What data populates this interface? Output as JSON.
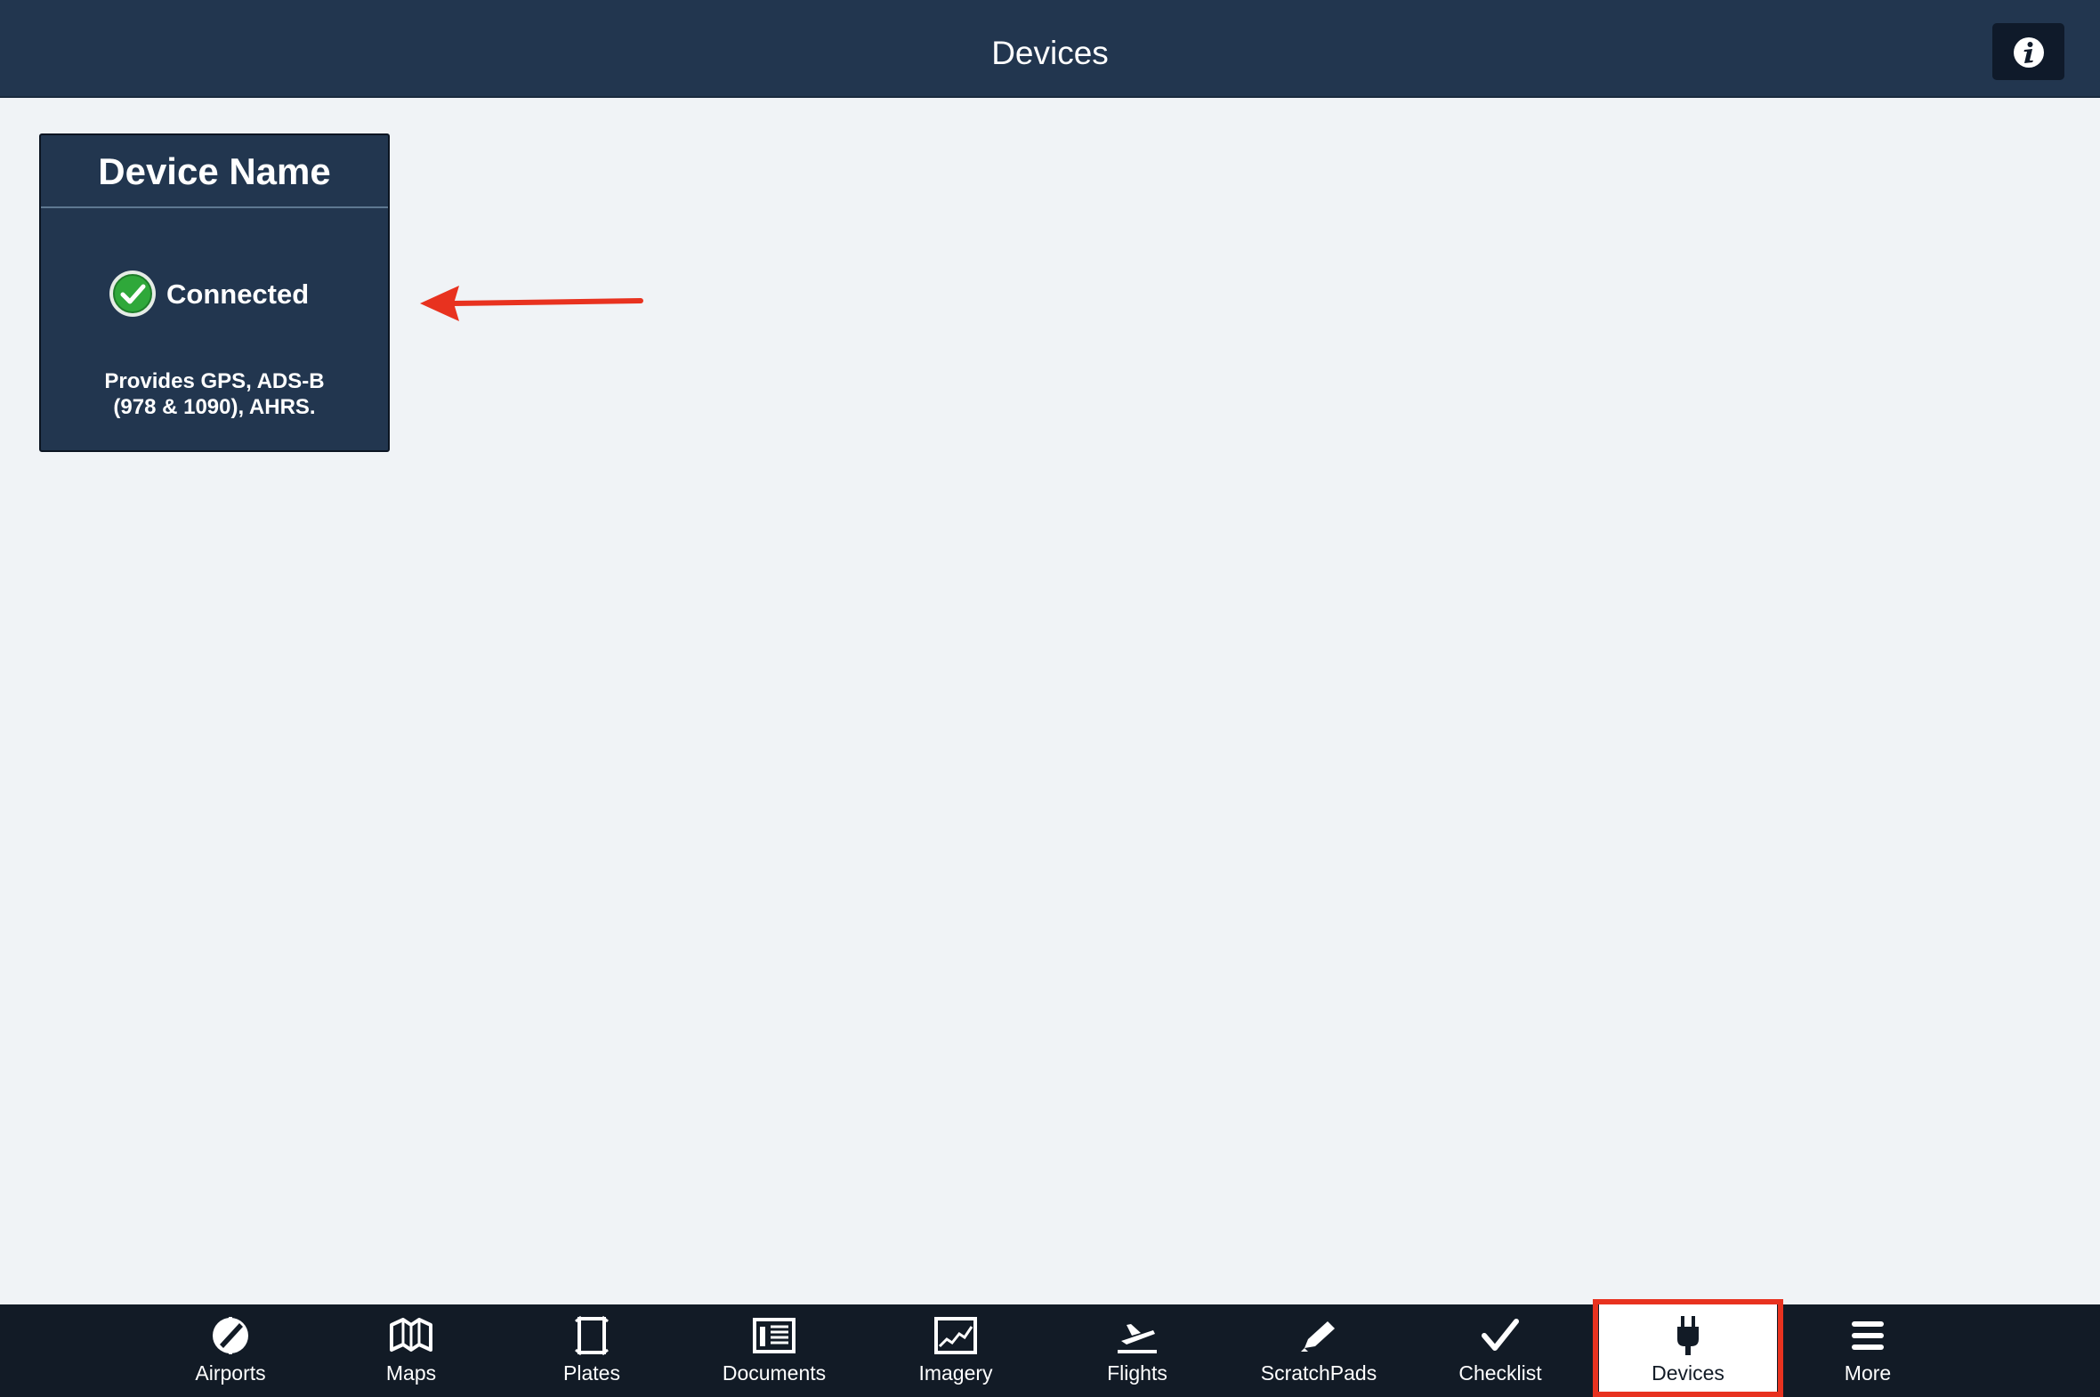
{
  "header": {
    "title": "Devices",
    "info_icon": "info-icon"
  },
  "device_card": {
    "name": "Device Name",
    "status": "Connected",
    "status_icon": "check-circle-icon",
    "status_color": "#2fa83a",
    "description_line1": "Provides GPS, ADS-B",
    "description_line2": "(978 & 1090), AHRS."
  },
  "annotation": {
    "arrow_color": "#e8321f"
  },
  "tabbar": {
    "items": [
      {
        "label": "Airports",
        "icon": "airport-icon"
      },
      {
        "label": "Maps",
        "icon": "map-icon"
      },
      {
        "label": "Plates",
        "icon": "plate-icon"
      },
      {
        "label": "Documents",
        "icon": "documents-icon"
      },
      {
        "label": "Imagery",
        "icon": "imagery-icon"
      },
      {
        "label": "Flights",
        "icon": "flights-icon"
      },
      {
        "label": "ScratchPads",
        "icon": "pencil-icon"
      },
      {
        "label": "Checklist",
        "icon": "checkmark-icon"
      },
      {
        "label": "Devices",
        "icon": "plug-icon",
        "active": true
      },
      {
        "label": "More",
        "icon": "menu-icon"
      }
    ],
    "highlight_color": "#e8321f"
  }
}
